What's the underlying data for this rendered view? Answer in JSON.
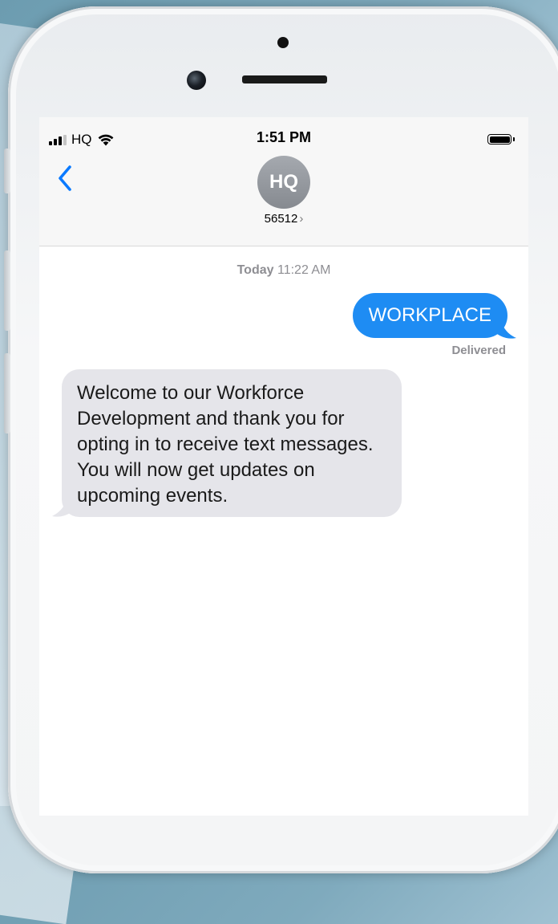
{
  "status_bar": {
    "carrier": "HQ",
    "time": "1:51 PM"
  },
  "conversation": {
    "avatar_initials": "HQ",
    "contact_number": "56512",
    "contact_chevron": "›"
  },
  "messages": {
    "timestamp_day": "Today",
    "timestamp_time": "11:22 AM",
    "sent_text": "WORKPLACE",
    "sent_status": "Delivered",
    "received_text": "Welcome to our Workforce Development and thank you for opting in to receive text messages. You will now get updates on upcoming events."
  },
  "colors": {
    "sent_bubble": "#1e8cf3",
    "received_bubble": "#e5e5ea",
    "accent_blue": "#0a7aff"
  },
  "icons": {
    "signal": "signal-bars-icon",
    "wifi": "wifi-icon",
    "battery": "battery-icon",
    "back": "back-chevron-icon"
  }
}
